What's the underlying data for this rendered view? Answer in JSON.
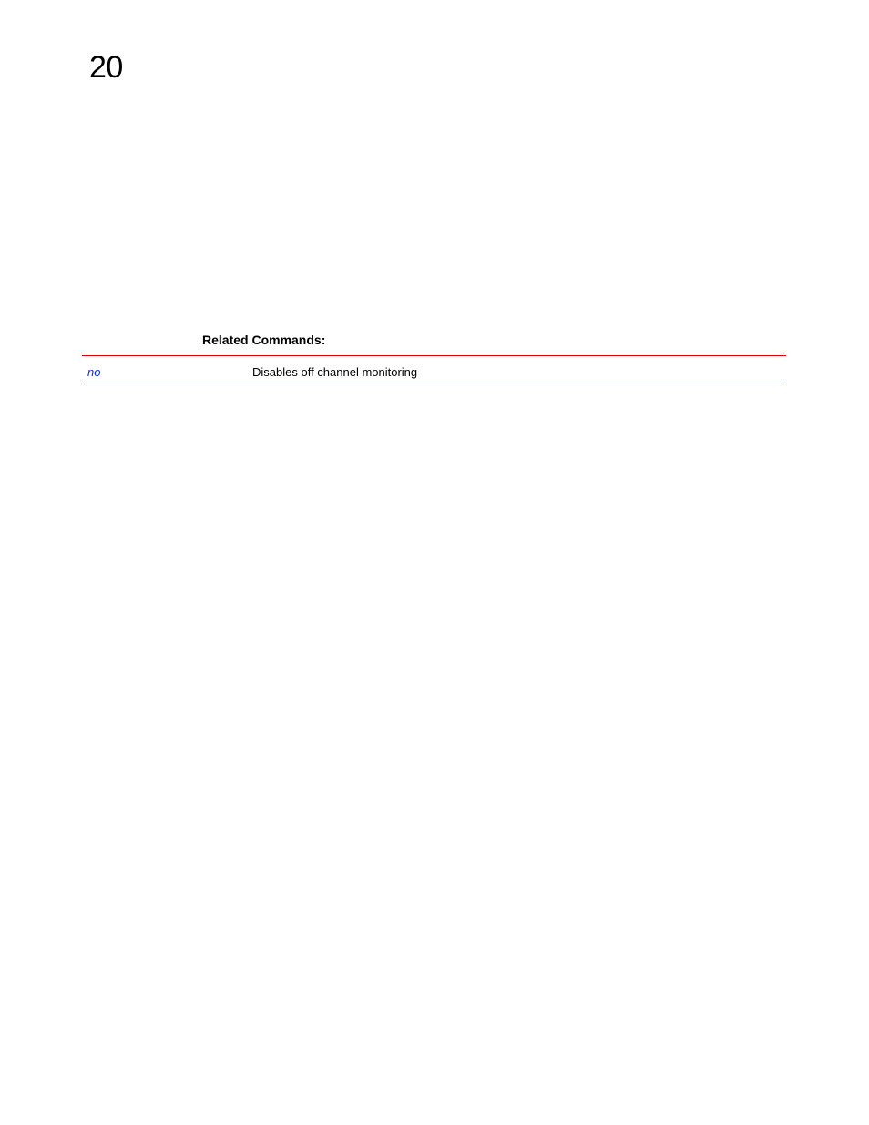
{
  "header": {
    "chapter_number": "20"
  },
  "section": {
    "heading": "Related Commands:"
  },
  "table": {
    "rows": [
      {
        "command": "no",
        "description": "Disables off channel monitoring"
      }
    ]
  }
}
